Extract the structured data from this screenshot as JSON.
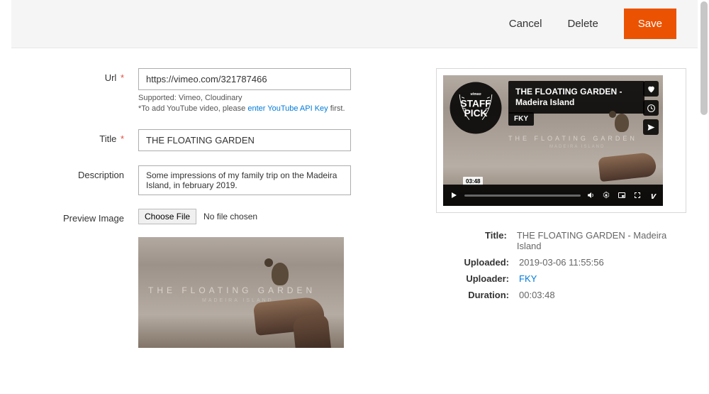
{
  "header": {
    "cancel": "Cancel",
    "delete": "Delete",
    "save": "Save"
  },
  "form": {
    "url_label": "Url",
    "url_value": "https://vimeo.com/321787466",
    "url_help_line1": "Supported: Vimeo, Cloudinary",
    "url_help_prefix": "*To add YouTube video, please ",
    "url_help_link": "enter YouTube API Key",
    "url_help_suffix": " first.",
    "title_label": "Title",
    "title_value": "THE FLOATING GARDEN",
    "description_label": "Description",
    "description_value": "Some impressions of my family trip on the Madeira Island, in february 2019.",
    "preview_label": "Preview Image",
    "choose_file": "Choose File",
    "no_file": "No file chosen",
    "preview_overlay_title": "THE FLOATING GARDEN",
    "preview_overlay_sub": "MADEIRA ISLAND"
  },
  "player": {
    "title_line": "THE FLOATING GARDEN - Madeira Island",
    "author_chip": "FKY",
    "faint_title": "THE FLOATING GARDEN",
    "faint_sub": "MADEIRA ISLAND",
    "time_badge": "03:48",
    "staff_pick_brand": "vimeo",
    "staff_pick_top": "STAFF",
    "staff_pick_bottom": "PICK"
  },
  "meta": {
    "title_label": "Title:",
    "title_value": "THE FLOATING GARDEN - Madeira Island",
    "uploaded_label": "Uploaded:",
    "uploaded_value": "2019-03-06 11:55:56",
    "uploader_label": "Uploader:",
    "uploader_value": "FKY",
    "duration_label": "Duration:",
    "duration_value": "00:03:48"
  }
}
